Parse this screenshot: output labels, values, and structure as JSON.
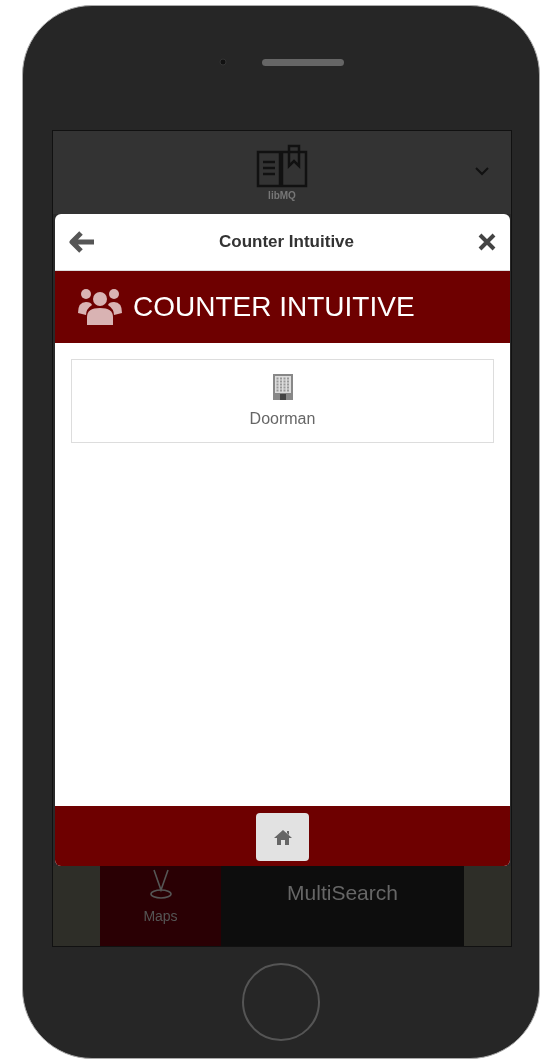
{
  "app_header": {
    "logo_text": "libMQ"
  },
  "tiles": [
    {
      "label": "Maps",
      "kind": "pin"
    },
    {
      "label": "MultiSearch",
      "kind": "text"
    }
  ],
  "dialog": {
    "title": "Counter Intuitive",
    "heading": "COUNTER INTUITIVE",
    "items": [
      {
        "label": "Doorman"
      }
    ]
  }
}
